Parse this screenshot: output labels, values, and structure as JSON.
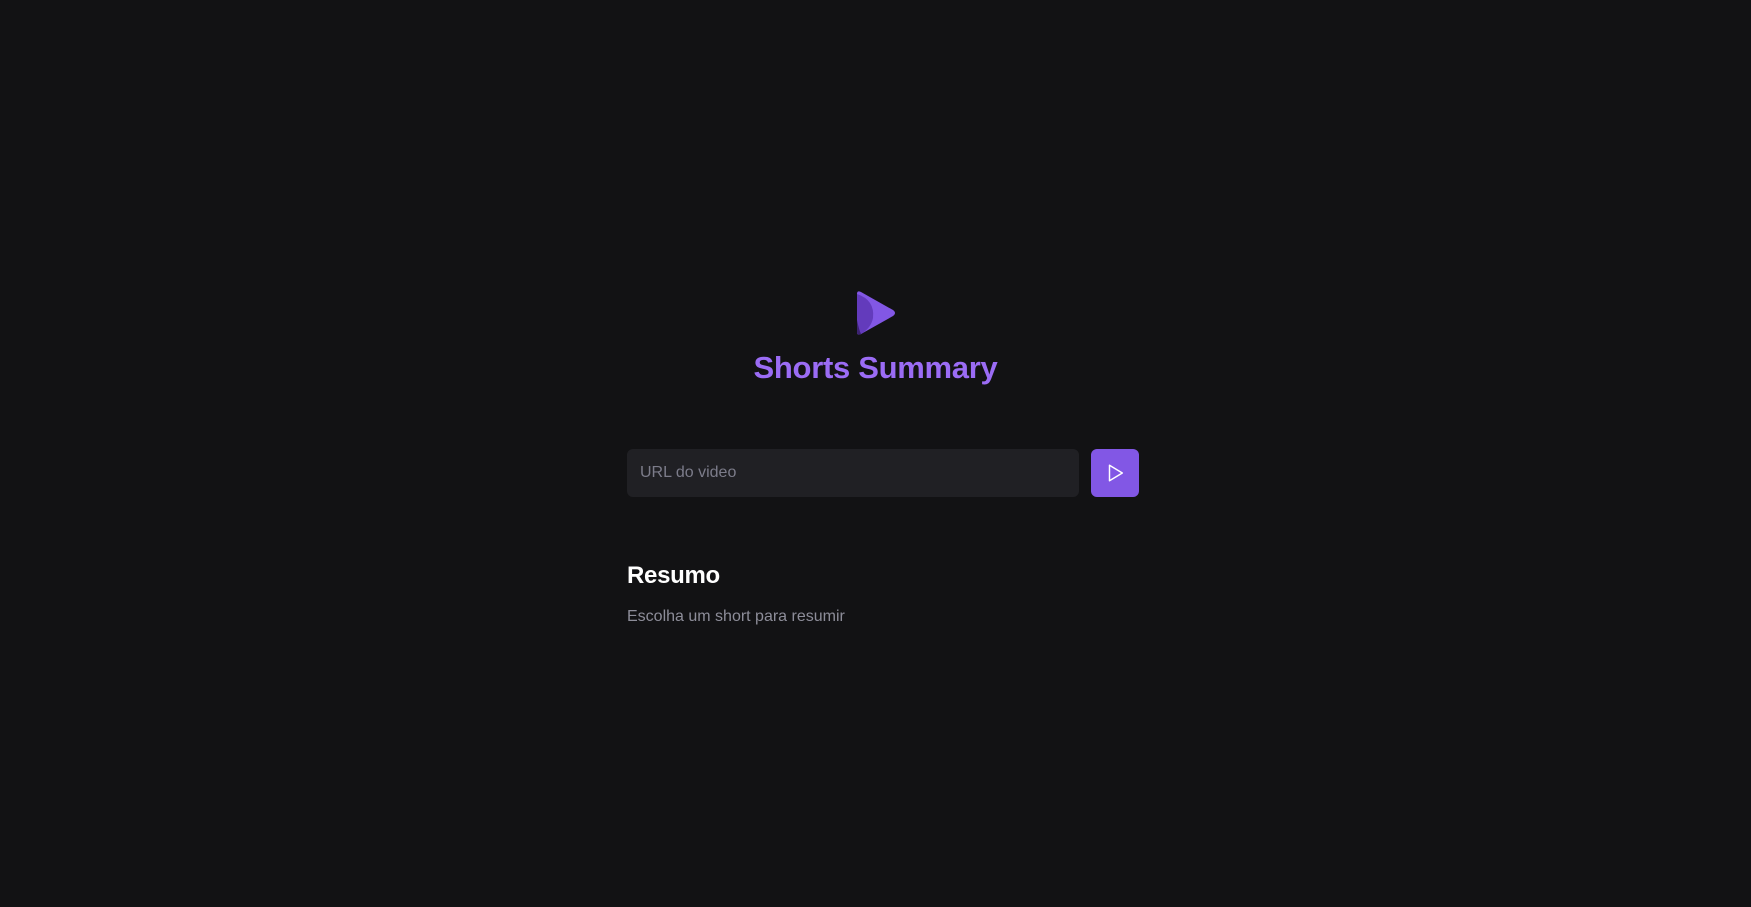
{
  "app": {
    "title": "Shorts Summary",
    "logo_icon": "play-logo-icon",
    "accent_color": "#8257e5",
    "title_color": "#9b6cf5"
  },
  "form": {
    "url_placeholder": "URL do video",
    "url_value": "",
    "submit_icon": "play-icon"
  },
  "summary": {
    "title": "Resumo",
    "text": "Escolha um short para resumir"
  }
}
